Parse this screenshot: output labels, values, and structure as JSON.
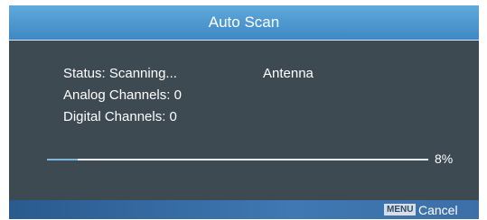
{
  "dialog": {
    "title": "Auto Scan",
    "status": "Status: Scanning...",
    "source": "Antenna",
    "analog": "Analog Channels: 0",
    "digital": "Digital Channels: 0",
    "progress_fraction": 0.08,
    "progress_text": "8%"
  },
  "footer": {
    "key": "MENU",
    "action": "Cancel"
  },
  "colors": {
    "title_bar": "#4f9bd3",
    "panel": "#3d4a52",
    "footer_bar": "#3469a1",
    "text": "#ffffff"
  }
}
